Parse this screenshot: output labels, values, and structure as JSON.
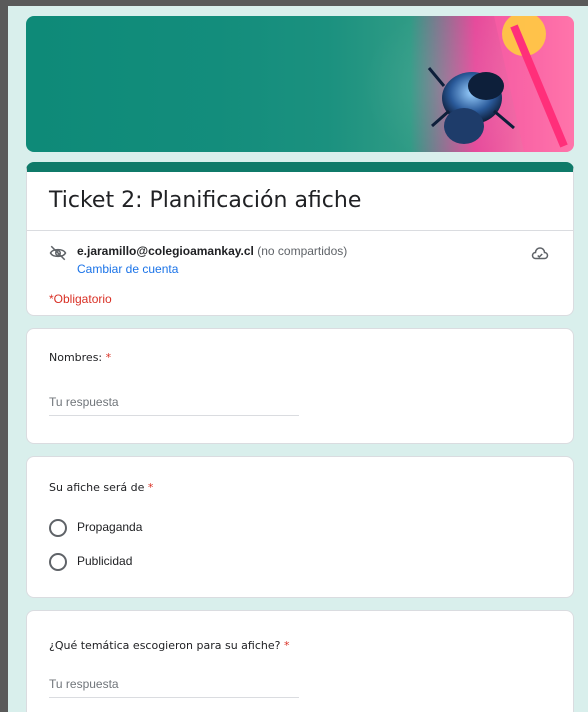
{
  "form": {
    "title": "Ticket 2: Planificación afiche",
    "account_email": "e.jaramillo@colegioamankay.cl",
    "account_note": "(no compartidos)",
    "switch_account": "Cambiar de cuenta",
    "required_note": "*Obligatorio"
  },
  "questions": [
    {
      "label": "Nombres:",
      "required": "*",
      "placeholder": "Tu respuesta"
    },
    {
      "label": "Su afiche será de",
      "required": "*",
      "options": [
        "Propaganda",
        "Publicidad"
      ]
    },
    {
      "label": "¿Qué temática escogieron para su afiche?",
      "required": "*",
      "placeholder": "Tu respuesta"
    }
  ],
  "colors": {
    "theme": "#0f7a69",
    "page_bg": "#d9efec",
    "required": "#d93025",
    "link": "#1a73e8"
  },
  "icons": [
    "hide-eye-icon",
    "cloud-icon"
  ]
}
